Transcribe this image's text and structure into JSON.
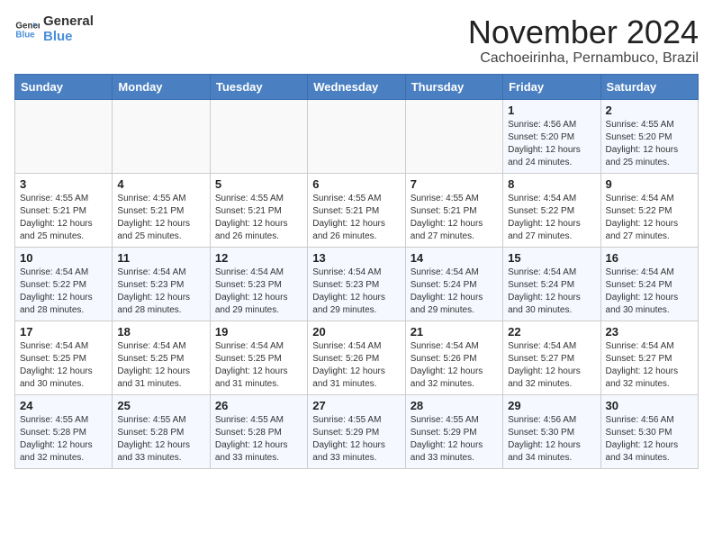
{
  "logo": {
    "line1": "General",
    "line2": "Blue"
  },
  "title": "November 2024",
  "location": "Cachoeirinha, Pernambuco, Brazil",
  "weekdays": [
    "Sunday",
    "Monday",
    "Tuesday",
    "Wednesday",
    "Thursday",
    "Friday",
    "Saturday"
  ],
  "weeks": [
    [
      {
        "day": "",
        "info": ""
      },
      {
        "day": "",
        "info": ""
      },
      {
        "day": "",
        "info": ""
      },
      {
        "day": "",
        "info": ""
      },
      {
        "day": "",
        "info": ""
      },
      {
        "day": "1",
        "info": "Sunrise: 4:56 AM\nSunset: 5:20 PM\nDaylight: 12 hours and 24 minutes."
      },
      {
        "day": "2",
        "info": "Sunrise: 4:55 AM\nSunset: 5:20 PM\nDaylight: 12 hours and 25 minutes."
      }
    ],
    [
      {
        "day": "3",
        "info": "Sunrise: 4:55 AM\nSunset: 5:21 PM\nDaylight: 12 hours and 25 minutes."
      },
      {
        "day": "4",
        "info": "Sunrise: 4:55 AM\nSunset: 5:21 PM\nDaylight: 12 hours and 25 minutes."
      },
      {
        "day": "5",
        "info": "Sunrise: 4:55 AM\nSunset: 5:21 PM\nDaylight: 12 hours and 26 minutes."
      },
      {
        "day": "6",
        "info": "Sunrise: 4:55 AM\nSunset: 5:21 PM\nDaylight: 12 hours and 26 minutes."
      },
      {
        "day": "7",
        "info": "Sunrise: 4:55 AM\nSunset: 5:21 PM\nDaylight: 12 hours and 27 minutes."
      },
      {
        "day": "8",
        "info": "Sunrise: 4:54 AM\nSunset: 5:22 PM\nDaylight: 12 hours and 27 minutes."
      },
      {
        "day": "9",
        "info": "Sunrise: 4:54 AM\nSunset: 5:22 PM\nDaylight: 12 hours and 27 minutes."
      }
    ],
    [
      {
        "day": "10",
        "info": "Sunrise: 4:54 AM\nSunset: 5:22 PM\nDaylight: 12 hours and 28 minutes."
      },
      {
        "day": "11",
        "info": "Sunrise: 4:54 AM\nSunset: 5:23 PM\nDaylight: 12 hours and 28 minutes."
      },
      {
        "day": "12",
        "info": "Sunrise: 4:54 AM\nSunset: 5:23 PM\nDaylight: 12 hours and 29 minutes."
      },
      {
        "day": "13",
        "info": "Sunrise: 4:54 AM\nSunset: 5:23 PM\nDaylight: 12 hours and 29 minutes."
      },
      {
        "day": "14",
        "info": "Sunrise: 4:54 AM\nSunset: 5:24 PM\nDaylight: 12 hours and 29 minutes."
      },
      {
        "day": "15",
        "info": "Sunrise: 4:54 AM\nSunset: 5:24 PM\nDaylight: 12 hours and 30 minutes."
      },
      {
        "day": "16",
        "info": "Sunrise: 4:54 AM\nSunset: 5:24 PM\nDaylight: 12 hours and 30 minutes."
      }
    ],
    [
      {
        "day": "17",
        "info": "Sunrise: 4:54 AM\nSunset: 5:25 PM\nDaylight: 12 hours and 30 minutes."
      },
      {
        "day": "18",
        "info": "Sunrise: 4:54 AM\nSunset: 5:25 PM\nDaylight: 12 hours and 31 minutes."
      },
      {
        "day": "19",
        "info": "Sunrise: 4:54 AM\nSunset: 5:25 PM\nDaylight: 12 hours and 31 minutes."
      },
      {
        "day": "20",
        "info": "Sunrise: 4:54 AM\nSunset: 5:26 PM\nDaylight: 12 hours and 31 minutes."
      },
      {
        "day": "21",
        "info": "Sunrise: 4:54 AM\nSunset: 5:26 PM\nDaylight: 12 hours and 32 minutes."
      },
      {
        "day": "22",
        "info": "Sunrise: 4:54 AM\nSunset: 5:27 PM\nDaylight: 12 hours and 32 minutes."
      },
      {
        "day": "23",
        "info": "Sunrise: 4:54 AM\nSunset: 5:27 PM\nDaylight: 12 hours and 32 minutes."
      }
    ],
    [
      {
        "day": "24",
        "info": "Sunrise: 4:55 AM\nSunset: 5:28 PM\nDaylight: 12 hours and 32 minutes."
      },
      {
        "day": "25",
        "info": "Sunrise: 4:55 AM\nSunset: 5:28 PM\nDaylight: 12 hours and 33 minutes."
      },
      {
        "day": "26",
        "info": "Sunrise: 4:55 AM\nSunset: 5:28 PM\nDaylight: 12 hours and 33 minutes."
      },
      {
        "day": "27",
        "info": "Sunrise: 4:55 AM\nSunset: 5:29 PM\nDaylight: 12 hours and 33 minutes."
      },
      {
        "day": "28",
        "info": "Sunrise: 4:55 AM\nSunset: 5:29 PM\nDaylight: 12 hours and 33 minutes."
      },
      {
        "day": "29",
        "info": "Sunrise: 4:56 AM\nSunset: 5:30 PM\nDaylight: 12 hours and 34 minutes."
      },
      {
        "day": "30",
        "info": "Sunrise: 4:56 AM\nSunset: 5:30 PM\nDaylight: 12 hours and 34 minutes."
      }
    ]
  ]
}
